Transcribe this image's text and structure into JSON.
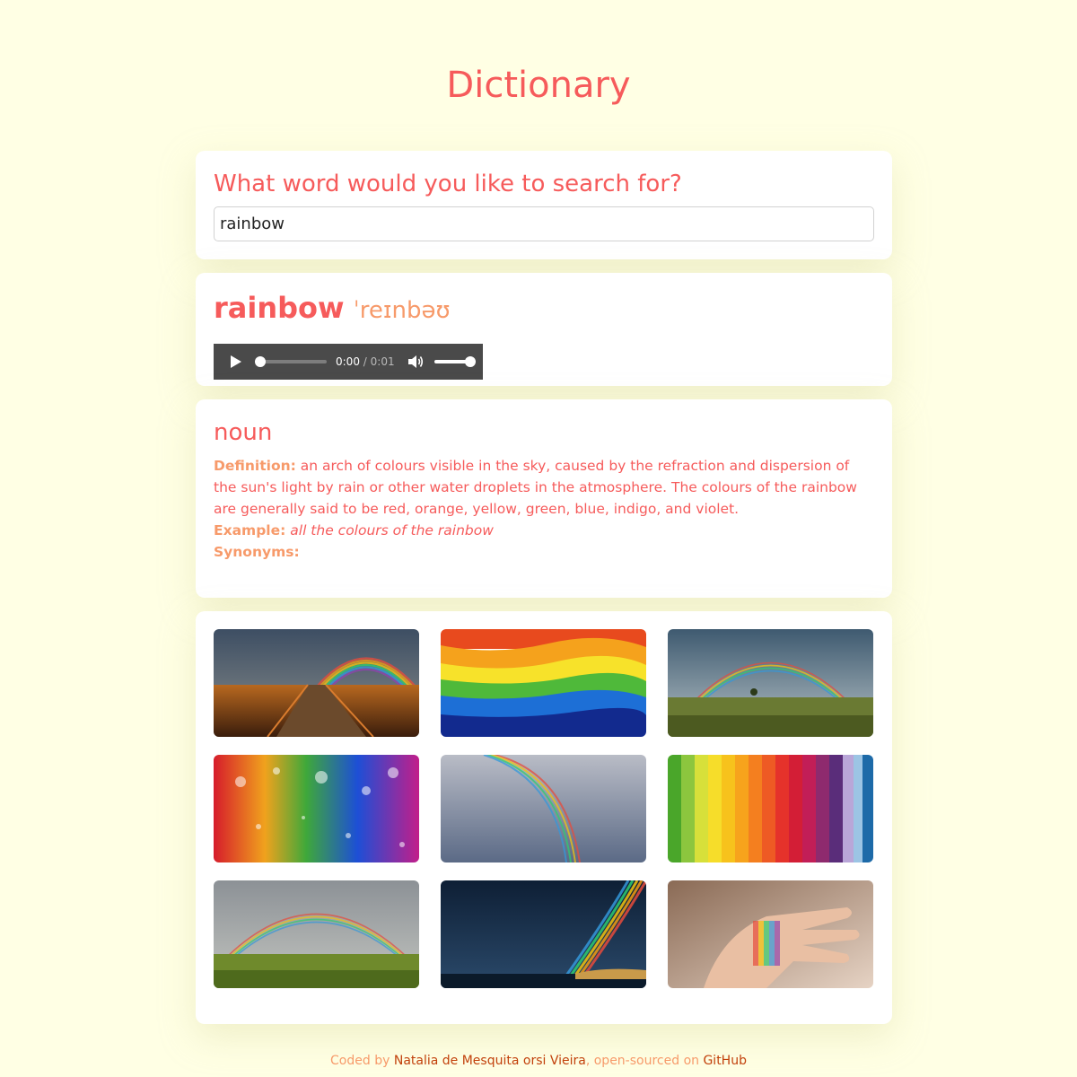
{
  "app": {
    "title": "Dictionary"
  },
  "search": {
    "heading": "What word would you like to search for?",
    "value": "rainbow"
  },
  "word": {
    "text": "rainbow",
    "phonetic": "ˈreɪnbəʊ",
    "audio": {
      "current_time": "0:00",
      "separator": "/",
      "duration": "0:01",
      "progress": 0.0,
      "volume": 1.0
    }
  },
  "meaning": {
    "part_of_speech": "noun",
    "definition_label": "Definition:",
    "definition": "an arch of colours visible in the sky, caused by the refraction and dispersion of the sun's light by rain or other water droplets in the atmosphere. The colours of the rainbow are generally said to be red, orange, yellow, green, blue, indigo, and violet.",
    "example_label": "Example:",
    "example": "all the colours of the rainbow",
    "synonyms_label": "Synonyms:"
  },
  "photos": [
    {
      "icon": "rainbow-boardwalk-photo"
    },
    {
      "icon": "rainbow-paint-photo"
    },
    {
      "icon": "rainbow-field-photo"
    },
    {
      "icon": "rainbow-glitter-photo"
    },
    {
      "icon": "rainbow-sky-photo"
    },
    {
      "icon": "rainbow-paper-strips-photo"
    },
    {
      "icon": "rainbow-meadow-photo"
    },
    {
      "icon": "rainbow-sea-photo"
    },
    {
      "icon": "rainbow-hand-photo"
    }
  ],
  "footer": {
    "coded_by": "Coded by ",
    "author": "Natalia de Mesquita orsi Vieira",
    "open_sourced": ", open-sourced on ",
    "github": "GitHub"
  },
  "colors": {
    "background": "#ffffe4",
    "accent": "#f65b5b",
    "accent_light": "#f79a6a",
    "link": "#c2410c"
  }
}
